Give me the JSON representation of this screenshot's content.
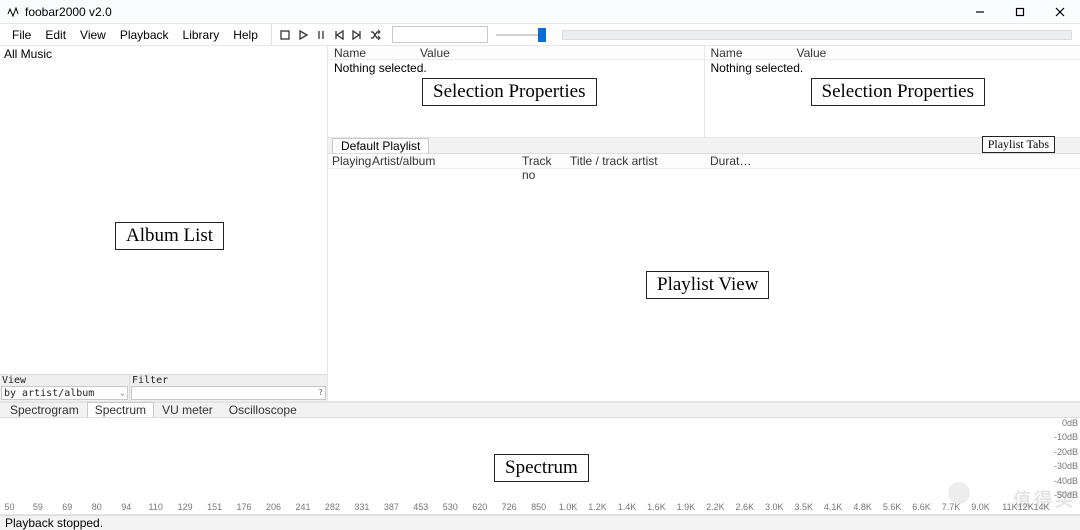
{
  "titlebar": {
    "title": "foobar2000 v2.0"
  },
  "menu": {
    "items": [
      "File",
      "Edit",
      "View",
      "Playback",
      "Library",
      "Help"
    ]
  },
  "toolbar": {
    "icons": [
      "stop-icon",
      "play-icon",
      "pause-icon",
      "prev-icon",
      "next-icon",
      "random-icon"
    ],
    "order_value": ""
  },
  "sidebar": {
    "root_label": "All Music",
    "controls": {
      "view_label": "View",
      "view_value": "by artist/album",
      "filter_label": "Filter",
      "filter_value": ""
    },
    "annotation": "Album List"
  },
  "selection_props": {
    "columns": {
      "name": "Name",
      "value": "Value"
    },
    "empty_text": "Nothing selected.",
    "annotation": "Selection Properties"
  },
  "playlist": {
    "tabs_annotation": "Playlist Tabs",
    "tab_active": "Default Playlist",
    "columns": {
      "playing": "Playing",
      "artist": "Artist/album",
      "trackno": "Track no",
      "title": "Title / track artist",
      "dur": "Durat…"
    },
    "view_annotation": "Playlist View"
  },
  "vis": {
    "tabs": [
      "Spectrogram",
      "Spectrum",
      "VU meter",
      "Oscilloscope"
    ],
    "active_index": 1,
    "annotation": "Spectrum",
    "db_labels": [
      "0dB",
      "-10dB",
      "-20dB",
      "-30dB",
      "-40dB",
      "-50dB"
    ]
  },
  "freq": {
    "ticks": [
      {
        "v": "50",
        "p": 0.9
      },
      {
        "v": "59",
        "p": 3.6
      },
      {
        "v": "69",
        "p": 6.4
      },
      {
        "v": "80",
        "p": 9.2
      },
      {
        "v": "94",
        "p": 12.0
      },
      {
        "v": "110",
        "p": 14.8
      },
      {
        "v": "129",
        "p": 17.6
      },
      {
        "v": "151",
        "p": 20.4
      },
      {
        "v": "176",
        "p": 23.2
      },
      {
        "v": "206",
        "p": 26.0
      },
      {
        "v": "241",
        "p": 28.8
      },
      {
        "v": "282",
        "p": 31.6
      },
      {
        "v": "331",
        "p": 34.4
      },
      {
        "v": "387",
        "p": 37.2
      },
      {
        "v": "453",
        "p": 40.0
      },
      {
        "v": "530",
        "p": 42.8
      },
      {
        "v": "620",
        "p": 45.6
      },
      {
        "v": "726",
        "p": 48.4
      },
      {
        "v": "850",
        "p": 51.2
      },
      {
        "v": "1.0K",
        "p": 54.0
      },
      {
        "v": "1.2K",
        "p": 56.8
      },
      {
        "v": "1.4K",
        "p": 59.6
      },
      {
        "v": "1.6K",
        "p": 62.4
      },
      {
        "v": "1.9K",
        "p": 65.2
      },
      {
        "v": "2.2K",
        "p": 68.0
      },
      {
        "v": "2.6K",
        "p": 70.8
      },
      {
        "v": "3.0K",
        "p": 73.6
      },
      {
        "v": "3.5K",
        "p": 76.4
      },
      {
        "v": "4.1K",
        "p": 79.2
      },
      {
        "v": "4.8K",
        "p": 82.0
      },
      {
        "v": "5.6K",
        "p": 84.8
      },
      {
        "v": "6.6K",
        "p": 87.6
      },
      {
        "v": "7.7K",
        "p": 90.4
      },
      {
        "v": "9.0K",
        "p": 93.2
      },
      {
        "v": "11K",
        "p": 96.0
      },
      {
        "v": "12K",
        "p": 97.5
      },
      {
        "v": "14K",
        "p": 99.0
      }
    ]
  },
  "status": {
    "text": "Playback stopped."
  },
  "watermark": {
    "text": "值得买"
  }
}
